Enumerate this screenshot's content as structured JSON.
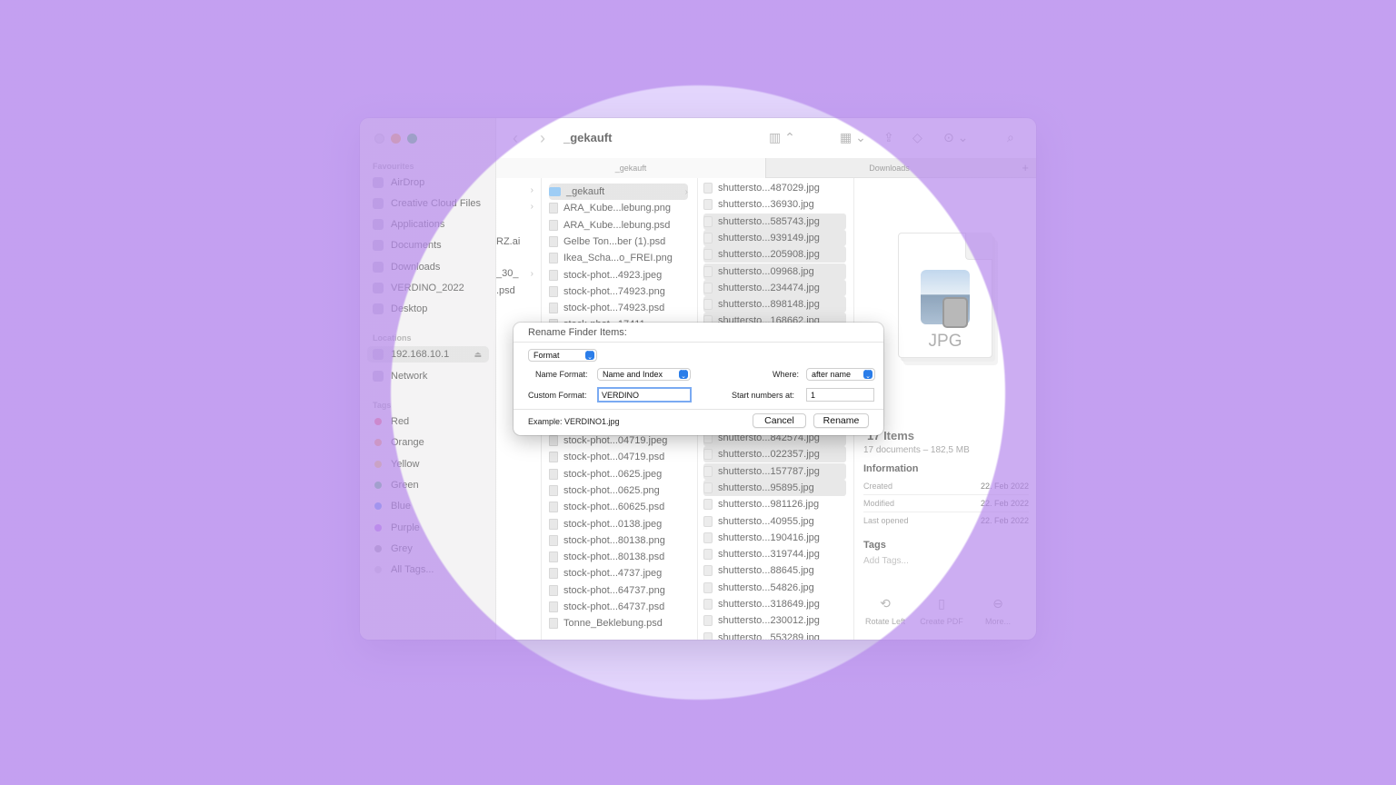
{
  "window": {
    "title": "_gekauft",
    "tabs": [
      "_gekauft",
      "Downloads"
    ]
  },
  "sidebar": {
    "favourites_header": "Favourites",
    "favourites": [
      "AirDrop",
      "Creative Cloud Files",
      "Applications",
      "Documents",
      "Downloads",
      "VERDINO_2022",
      "Desktop"
    ],
    "locations_header": "Locations",
    "locations": [
      "192.168.10.1",
      "Network"
    ],
    "tags_header": "Tags",
    "tags": [
      {
        "label": "Red",
        "color": "#ff5a5a"
      },
      {
        "label": "Orange",
        "color": "#ff9a3c"
      },
      {
        "label": "Yellow",
        "color": "#f7d23a"
      },
      {
        "label": "Green",
        "color": "#43c55a"
      },
      {
        "label": "Blue",
        "color": "#3d8ff0"
      },
      {
        "label": "Purple",
        "color": "#b36ae6"
      },
      {
        "label": "Grey",
        "color": "#9a9a9a"
      },
      {
        "label": "All Tags...",
        "color": "#cfcfcf"
      }
    ]
  },
  "column0": [
    "RZ.ai",
    "_30_",
    ".psd"
  ],
  "column1": {
    "top": [
      "_gekauft",
      "ARA_Kube...lebung.png",
      "ARA_Kube...lebung.psd",
      "Gelbe Ton...ber (1).psd",
      "Ikea_Scha...o_FREI.png",
      "stock-phot...4923.jpeg",
      "stock-phot...74923.png",
      "stock-phot...74923.psd",
      "stock-phot...17411..."
    ],
    "bottom": [
      "stock-phot...04719.jpeg",
      "stock-phot...04719.psd",
      "stock-phot...0625.jpeg",
      "stock-phot...0625.png",
      "stock-phot...60625.psd",
      "stock-phot...0138.jpeg",
      "stock-phot...80138.png",
      "stock-phot...80138.psd",
      "stock-phot...4737.jpeg",
      "stock-phot...64737.png",
      "stock-phot...64737.psd",
      "Tonne_Beklebung.psd"
    ]
  },
  "column2": {
    "top": [
      "shuttersto...487029.jpg",
      "shuttersto...36930.jpg",
      "shuttersto...585743.jpg",
      "shuttersto...939149.jpg",
      "shuttersto...205908.jpg",
      "shuttersto...09968.jpg",
      "shuttersto...234474.jpg",
      "shuttersto...898148.jpg",
      "shuttersto...168662.jpg"
    ],
    "bottom": [
      "shuttersto...842574.jpg",
      "shuttersto...022357.jpg",
      "shuttersto...157787.jpg",
      "shuttersto...95895.jpg",
      "shuttersto...981126.jpg",
      "shuttersto...40955.jpg",
      "shuttersto...190416.jpg",
      "shuttersto...319744.jpg",
      "shuttersto...88645.jpg",
      "shuttersto...54826.jpg",
      "shuttersto...318649.jpg",
      "shuttersto...230012.jpg",
      "shuttersto...553289.jpg"
    ]
  },
  "preview": {
    "doc_label": "JPG",
    "items_count": "17 Items",
    "items_sub": "17 documents – 182,5 MB",
    "info_header": "Information",
    "info": [
      {
        "key": "Created",
        "value": "22. Feb 2022"
      },
      {
        "key": "Modified",
        "value": "22. Feb 2022"
      },
      {
        "key": "Last opened",
        "value": "22. Feb 2022"
      }
    ],
    "tags_header": "Tags",
    "tags_placeholder": "Add Tags...",
    "actions": [
      "Rotate Left",
      "Create PDF",
      "More..."
    ]
  },
  "dialog": {
    "title": "Rename Finder Items:",
    "mode": "Format",
    "name_format_label": "Name Format:",
    "name_format_value": "Name and Index",
    "where_label": "Where:",
    "where_value": "after name",
    "custom_format_label": "Custom Format:",
    "custom_format_value": "VERDINO",
    "start_label": "Start numbers at:",
    "start_value": "1",
    "example": "Example: VERDINO1.jpg",
    "cancel_label": "Cancel",
    "rename_label": "Rename"
  },
  "colors": {
    "background": "#d7c3fb",
    "accent": "#2a7de9"
  }
}
